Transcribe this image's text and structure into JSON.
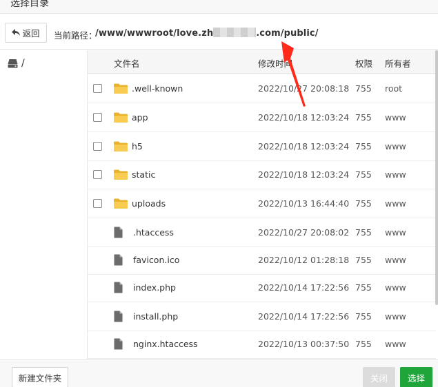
{
  "dialog": {
    "title": "选择目录"
  },
  "path_bar": {
    "back_label": "返回",
    "path_label": "当前路径：",
    "path_prefix": "/www/wwwroot/love.zh",
    "path_suffix": ".com/public/"
  },
  "sidebar": {
    "root_label": "/"
  },
  "table": {
    "headers": {
      "name": "文件名",
      "modified": "修改时间",
      "permission": "权限",
      "owner": "所有者"
    },
    "rows": [
      {
        "type": "folder",
        "name": ".well-known",
        "modified": "2022/10/27 20:08:18",
        "permission": "755",
        "owner": "root"
      },
      {
        "type": "folder",
        "name": "app",
        "modified": "2022/10/18 12:03:24",
        "permission": "755",
        "owner": "www"
      },
      {
        "type": "folder",
        "name": "h5",
        "modified": "2022/10/18 12:03:24",
        "permission": "755",
        "owner": "www"
      },
      {
        "type": "folder",
        "name": "static",
        "modified": "2022/10/18 12:03:24",
        "permission": "755",
        "owner": "www"
      },
      {
        "type": "folder",
        "name": "uploads",
        "modified": "2022/10/13 16:44:40",
        "permission": "755",
        "owner": "www"
      },
      {
        "type": "file",
        "name": ".htaccess",
        "modified": "2022/10/27 20:08:02",
        "permission": "755",
        "owner": "www"
      },
      {
        "type": "file",
        "name": "favicon.ico",
        "modified": "2022/10/12 01:28:18",
        "permission": "755",
        "owner": "www"
      },
      {
        "type": "file",
        "name": "index.php",
        "modified": "2022/10/14 17:22:56",
        "permission": "755",
        "owner": "www"
      },
      {
        "type": "file",
        "name": "install.php",
        "modified": "2022/10/14 17:22:56",
        "permission": "755",
        "owner": "www"
      },
      {
        "type": "file",
        "name": "nginx.htaccess",
        "modified": "2022/10/13 00:37:50",
        "permission": "755",
        "owner": "www"
      }
    ]
  },
  "footer": {
    "new_folder_label": "新建文件夹",
    "close_label": "关闭",
    "select_label": "选择"
  },
  "colors": {
    "folder": "#f5c542",
    "file": "#6b6b6b",
    "primary": "#20a53a",
    "disabled": "#dcdcdc",
    "annotation": "#ff2a1a"
  },
  "icons": {
    "back": "back-arrow-icon",
    "drive": "hard-drive-icon",
    "folder": "folder-icon",
    "file": "file-icon"
  }
}
